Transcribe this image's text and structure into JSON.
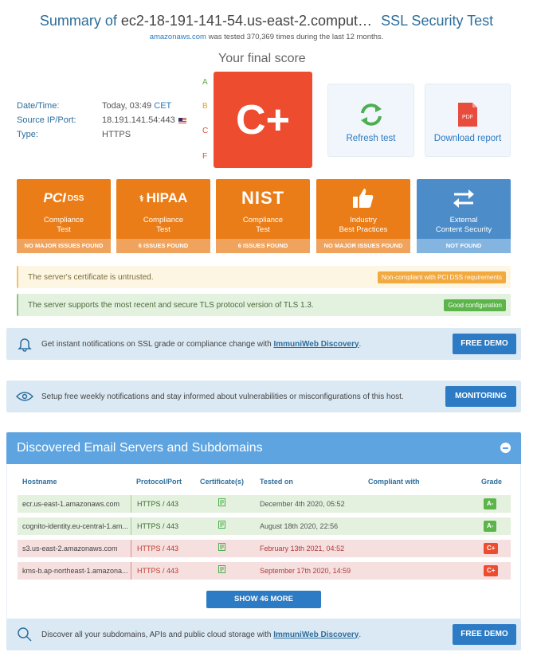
{
  "header": {
    "title_prefix": "Summary of",
    "host": "ec2-18-191-141-54.us-east-2.comput…",
    "test_name": "SSL Security Test",
    "subtitle_link": "amazonaws.com",
    "subtitle_rest": " was tested 370,369 times during the last 12 months."
  },
  "score": {
    "heading": "Your final score",
    "grade": "C+",
    "scale": [
      "A",
      "B",
      "C",
      "F"
    ]
  },
  "info": {
    "date_label": "Date/Time:",
    "date_value": "Today, 03:49",
    "date_tz": "CET",
    "ip_label": "Source IP/Port:",
    "ip_value": "18.191.141.54:443",
    "type_label": "Type:",
    "type_value": "HTTPS"
  },
  "actions": {
    "refresh": "Refresh test",
    "download": "Download report",
    "pdf_label": "PDF"
  },
  "cards": [
    {
      "logo": "PCI DSS",
      "line1": "Compliance",
      "line2": "Test",
      "status": "NO MAJOR ISSUES FOUND"
    },
    {
      "logo": "HIPAA",
      "line1": "Compliance",
      "line2": "Test",
      "status": "6 ISSUES FOUND"
    },
    {
      "logo": "NIST",
      "line1": "Compliance",
      "line2": "Test",
      "status": "6 ISSUES FOUND"
    },
    {
      "logo": "",
      "line1": "Industry",
      "line2": "Best Practices",
      "status": "NO MAJOR ISSUES FOUND"
    },
    {
      "logo": "",
      "line1": "External",
      "line2": "Content Security",
      "status": "NOT FOUND"
    }
  ],
  "alerts": {
    "warn_text": "The server's certificate is untrusted.",
    "warn_badge": "Non-compliant with PCI DSS requirements",
    "ok_text": "The server supports the most recent and secure TLS protocol version of TLS 1.3.",
    "ok_badge": "Good configuration"
  },
  "banners": {
    "notify_text": "Get instant notifications on SSL grade or compliance change with ",
    "notify_link": "ImmuniWeb Discovery",
    "notify_end": ".",
    "notify_btn": "FREE DEMO",
    "monitor_text": "Setup free weekly notifications and stay informed about vulnerabilities or misconfigurations of this host.",
    "monitor_btn": "MONITORING",
    "discover_text": "Discover all your subdomains, APIs and public cloud storage with ",
    "discover_link": "ImmuniWeb Discovery",
    "discover_end": ".",
    "discover_btn": "FREE DEMO"
  },
  "discovered": {
    "title": "Discovered Email Servers and Subdomains",
    "columns": [
      "Hostname",
      "Protocol/Port",
      "Certificate(s)",
      "Tested on",
      "Compliant with",
      "Grade"
    ],
    "rows": [
      {
        "host": "ecr.us-east-1.amazonaws.com",
        "proto": "HTTPS / 443",
        "date": "December 4th 2020, 05:52",
        "grade": "A-",
        "status": "green"
      },
      {
        "host": "cognito-identity.eu-central-1.am...",
        "proto": "HTTPS / 443",
        "date": "August 18th 2020, 22:56",
        "grade": "A-",
        "status": "green"
      },
      {
        "host": "s3.us-east-2.amazonaws.com",
        "proto": "HTTPS / 443",
        "date": "February 13th 2021, 04:52",
        "grade": "C+",
        "status": "red"
      },
      {
        "host": "kms-b.ap-northeast-1.amazona...",
        "proto": "HTTPS / 443",
        "date": "September 17th 2020, 14:59",
        "grade": "C+",
        "status": "red"
      }
    ],
    "more_btn": "SHOW 46 MORE"
  },
  "colors": {
    "accent": "#2d7bc4",
    "grade": "#ee4c2e",
    "card": "#ea7d18",
    "card_blue": "#4b8cc9"
  }
}
